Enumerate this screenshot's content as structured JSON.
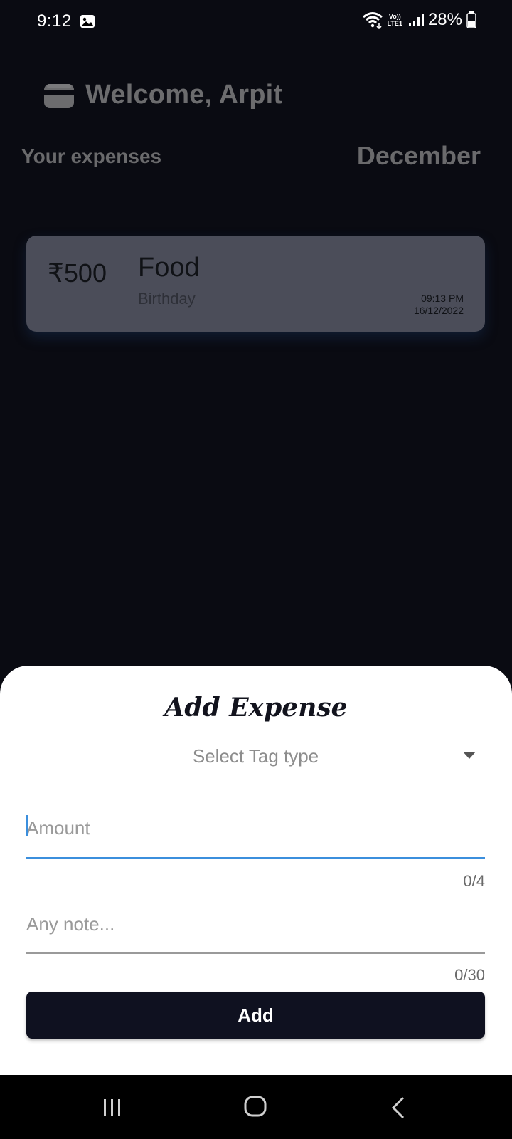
{
  "status_bar": {
    "time": "9:12",
    "volte_top": "Vo))",
    "volte_bottom": "LTE1",
    "battery": "28%"
  },
  "header": {
    "welcome": "Welcome, Arpit",
    "section_label": "Your expenses",
    "month": "December"
  },
  "expenses": [
    {
      "amount": "₹500",
      "tag": "Food",
      "note": "Birthday",
      "time": "09:13 PM",
      "date": "16/12/2022"
    }
  ],
  "sheet": {
    "title": "Add Expense",
    "tag_select_placeholder": "Select Tag type",
    "amount_placeholder": "Amount",
    "amount_counter": "0/4",
    "note_placeholder": "Any note...",
    "note_counter": "0/30",
    "add_label": "Add"
  },
  "colors": {
    "background": "#0a0b12",
    "card": "#4b4d59",
    "accent": "#3b8fdd",
    "button": "#0f1120"
  },
  "icons": {
    "status": [
      "gallery-icon",
      "wifi-icon",
      "volte-icon",
      "signal-icon",
      "battery-icon"
    ],
    "app": [
      "wallet-icon",
      "chevron-down-icon"
    ],
    "nav": [
      "recents-icon",
      "home-icon",
      "back-icon"
    ]
  }
}
